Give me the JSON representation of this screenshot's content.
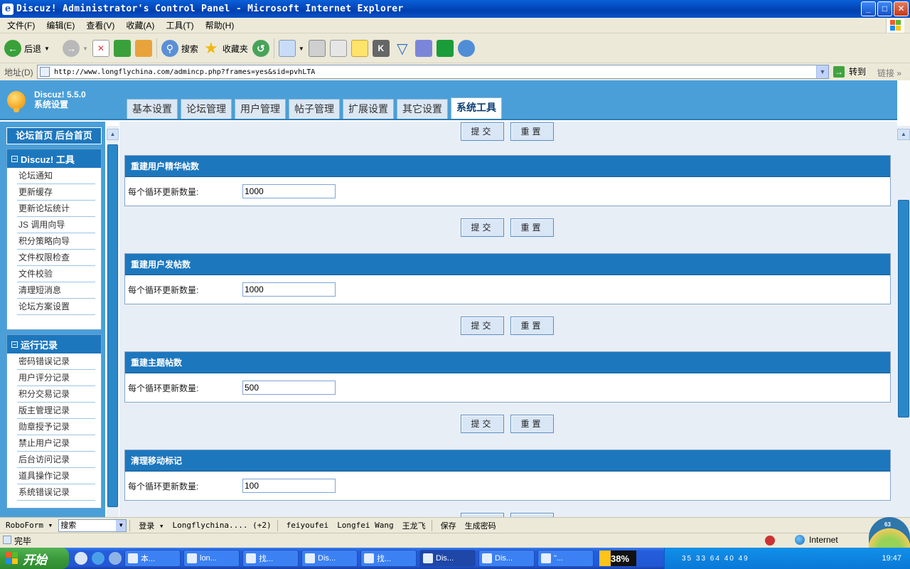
{
  "window": {
    "title": "Discuz! Administrator's Control Panel - Microsoft Internet Explorer",
    "min": "_",
    "max": "□",
    "close": "✕"
  },
  "menubar": [
    "文件(F)",
    "编辑(E)",
    "查看(V)",
    "收藏(A)",
    "工具(T)",
    "帮助(H)"
  ],
  "toolbar": {
    "back": "后退",
    "search": "搜索",
    "favorites": "收藏夹"
  },
  "address": {
    "label": "地址(D)",
    "url": "http://www.longflychina.com/admincp.php?frames=yes&sid=pvhLTA",
    "go": "转到",
    "links": "链接"
  },
  "header": {
    "brand_line1": "Discuz! 5.5.0",
    "brand_line2": "系统设置",
    "tabs": [
      "基本设置",
      "论坛管理",
      "用户管理",
      "帖子管理",
      "扩展设置",
      "其它设置",
      "系统工具"
    ],
    "active_tab": "系统工具"
  },
  "sidebar": {
    "home_links": "论坛首页 后台首页",
    "groups": [
      {
        "title": "Discuz! 工具",
        "toggle": "−",
        "items": [
          "论坛通知",
          "更新缓存",
          "更新论坛统计",
          "JS 调用向导",
          "积分策略向导",
          "文件权限检查",
          "文件校验",
          "清理短消息",
          "论坛方案设置"
        ]
      },
      {
        "title": "运行记录",
        "toggle": "−",
        "items": [
          "密码错误记录",
          "用户评分记录",
          "积分交易记录",
          "版主管理记录",
          "勋章授予记录",
          "禁止用户记录",
          "后台访问记录",
          "道具操作记录",
          "系统错误记录"
        ]
      }
    ]
  },
  "main": {
    "submit": "提交",
    "reset": "重置",
    "sections": [
      {
        "title": "重建用户精华帖数",
        "label": "每个循环更新数量:",
        "value": "1000"
      },
      {
        "title": "重建用户发帖数",
        "label": "每个循环更新数量:",
        "value": "1000"
      },
      {
        "title": "重建主题帖数",
        "label": "每个循环更新数量:",
        "value": "500"
      },
      {
        "title": "清理移动标记",
        "label": "每个循环更新数量:",
        "value": "100"
      }
    ]
  },
  "robobar": {
    "roboform": "RoboForm",
    "search": "搜索",
    "login": "登录",
    "site": "Longflychina....",
    "site_count": "(+2)",
    "id1": "feiyoufei",
    "id2": "Longfei Wang",
    "id3": "王龙飞",
    "save": "保存",
    "gen_pass": "生成密码"
  },
  "statusbar": {
    "status": "完毕",
    "zone": "Internet"
  },
  "taskbar": {
    "start": "开始",
    "tasks": [
      "本...",
      "lon...",
      "找...",
      "Dis...",
      "找...",
      "Dis...",
      "Dis...",
      "\"..."
    ],
    "active_task_index": 5,
    "cpu": "38%",
    "tray_numbers": "35 33 64 40 49",
    "clock": "19:47",
    "gauge": "63"
  }
}
